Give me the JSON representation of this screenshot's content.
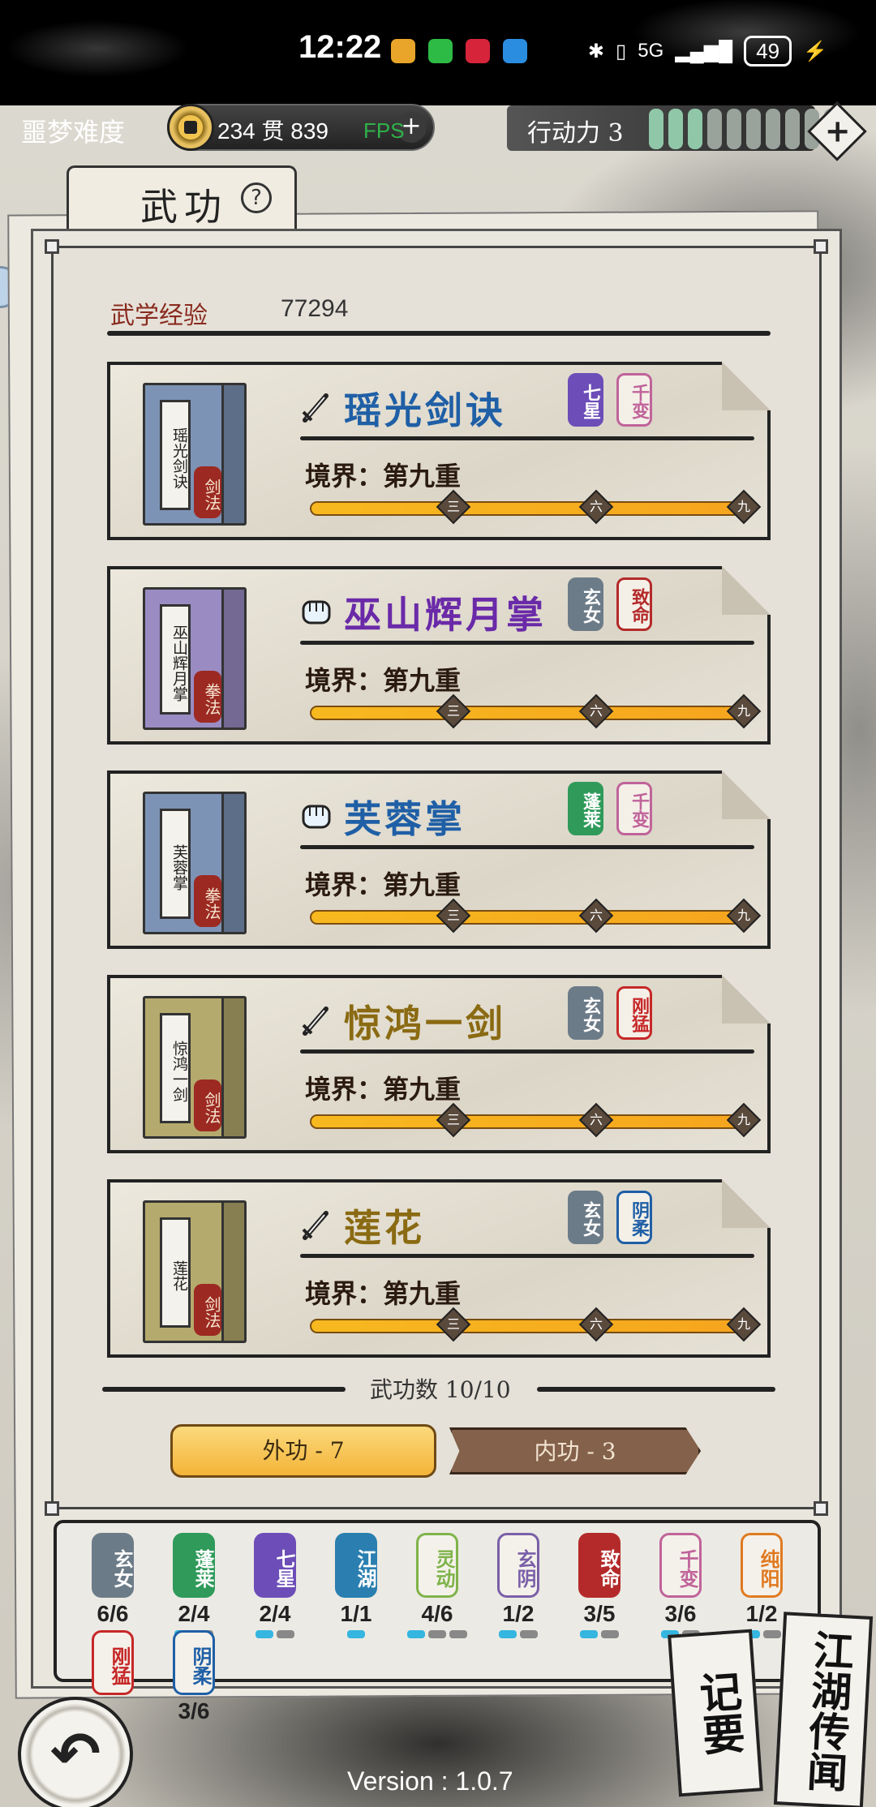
{
  "status_bar": {
    "time": "12:22",
    "network": "5G",
    "battery": "49"
  },
  "header": {
    "difficulty": "噩梦难度",
    "coins_text": "234 贯 839",
    "fps_label": "FPS",
    "action_label": "行动力 3",
    "action_points": 3,
    "action_max": 10
  },
  "tab": {
    "title": "武功",
    "help": "?"
  },
  "experience": {
    "label": "武学经验",
    "value": "77294"
  },
  "skills": [
    {
      "name": "瑶光剑诀",
      "book_title": "瑶光剑诀",
      "book_type": "剑法",
      "icon": "sword-icon",
      "name_color": "#1f5fa6",
      "book_color": "#7d93b6",
      "tags": [
        {
          "text": "七星",
          "style": "solid",
          "color": "#6d4db8"
        },
        {
          "text": "千变",
          "style": "outline",
          "color": "#c0639a"
        }
      ],
      "realm": "境界：第九重",
      "marks": [
        "三",
        "六",
        "九"
      ],
      "progress": 1.0
    },
    {
      "name": "巫山辉月掌",
      "book_title": "巫山辉月掌",
      "book_type": "拳法",
      "icon": "fist-icon",
      "name_color": "#6a2aa8",
      "book_color": "#9a8cc3",
      "tags": [
        {
          "text": "玄女",
          "style": "solid",
          "color": "#6c7b88"
        },
        {
          "text": "致命",
          "style": "outline",
          "color": "#b42a2a"
        }
      ],
      "realm": "境界：第九重",
      "marks": [
        "三",
        "六",
        "九"
      ],
      "progress": 1.0
    },
    {
      "name": "芙蓉掌",
      "book_title": "芙蓉掌",
      "book_type": "拳法",
      "icon": "fist-icon",
      "name_color": "#1f5fa6",
      "book_color": "#7d93b6",
      "tags": [
        {
          "text": "蓬莱",
          "style": "solid",
          "color": "#2f9a5a"
        },
        {
          "text": "千变",
          "style": "outline",
          "color": "#c0639a"
        }
      ],
      "realm": "境界：第九重",
      "marks": [
        "三",
        "六",
        "九"
      ],
      "progress": 1.0
    },
    {
      "name": "惊鸿一剑",
      "book_title": "惊鸿一剑",
      "book_type": "剑法",
      "icon": "sword-icon",
      "name_color": "#8a6a12",
      "book_color": "#b5aa6d",
      "tags": [
        {
          "text": "玄女",
          "style": "solid",
          "color": "#6c7b88"
        },
        {
          "text": "刚猛",
          "style": "outline",
          "color": "#c62828"
        }
      ],
      "realm": "境界：第九重",
      "marks": [
        "三",
        "六",
        "九"
      ],
      "progress": 1.0
    },
    {
      "name": "莲花",
      "book_title": "莲花",
      "book_type": "剑法",
      "icon": "sword-icon",
      "name_color": "#8a6a12",
      "book_color": "#b5aa6d",
      "tags": [
        {
          "text": "玄女",
          "style": "solid",
          "color": "#6c7b88"
        },
        {
          "text": "阴柔",
          "style": "outline",
          "color": "#1f5fa6"
        }
      ],
      "realm": "境界：第九重",
      "marks": [
        "三",
        "六",
        "九"
      ],
      "progress": 1.0
    }
  ],
  "skill_count": "武功数 10/10",
  "buttons": {
    "outer": "外功 - 7",
    "inner": "内功 - 3"
  },
  "factions": [
    {
      "name": "玄女",
      "count": "6/6",
      "color": "#6c7b88",
      "style": "solid",
      "filled": 0,
      "total": 0
    },
    {
      "name": "蓬莱",
      "count": "2/4",
      "color": "#2f9a5a",
      "style": "solid",
      "filled": 1,
      "total": 2
    },
    {
      "name": "七星",
      "count": "2/4",
      "color": "#6d4db8",
      "style": "solid",
      "filled": 1,
      "total": 2
    },
    {
      "name": "江湖",
      "count": "1/1",
      "color": "#2a7fb0",
      "style": "solid",
      "filled": 1,
      "total": 1
    },
    {
      "name": "灵动",
      "count": "4/6",
      "color": "#7fb34a",
      "style": "outline",
      "filled": 1,
      "total": 3
    },
    {
      "name": "玄阴",
      "count": "1/2",
      "color": "#7a5fa8",
      "style": "outline",
      "filled": 1,
      "total": 2
    },
    {
      "name": "致命",
      "count": "3/5",
      "color": "#b42a2a",
      "style": "solid",
      "filled": 1,
      "total": 2
    },
    {
      "name": "千变",
      "count": "3/6",
      "color": "#c0639a",
      "style": "outline",
      "filled": 1,
      "total": 2
    },
    {
      "name": "纯阳",
      "count": "1/2",
      "color": "#e07a20",
      "style": "outline",
      "filled": 1,
      "total": 2
    },
    {
      "name": "刚猛",
      "count": "",
      "color": "#c62828",
      "style": "outline",
      "filled": 0,
      "total": 0
    },
    {
      "name": "阴柔",
      "count": "3/6",
      "color": "#1f5fa6",
      "style": "outline",
      "filled": 0,
      "total": 0
    }
  ],
  "bottom": {
    "version": "Version : 1.0.7",
    "notes_label": "记要",
    "rumors_label": "江湖传闻"
  }
}
